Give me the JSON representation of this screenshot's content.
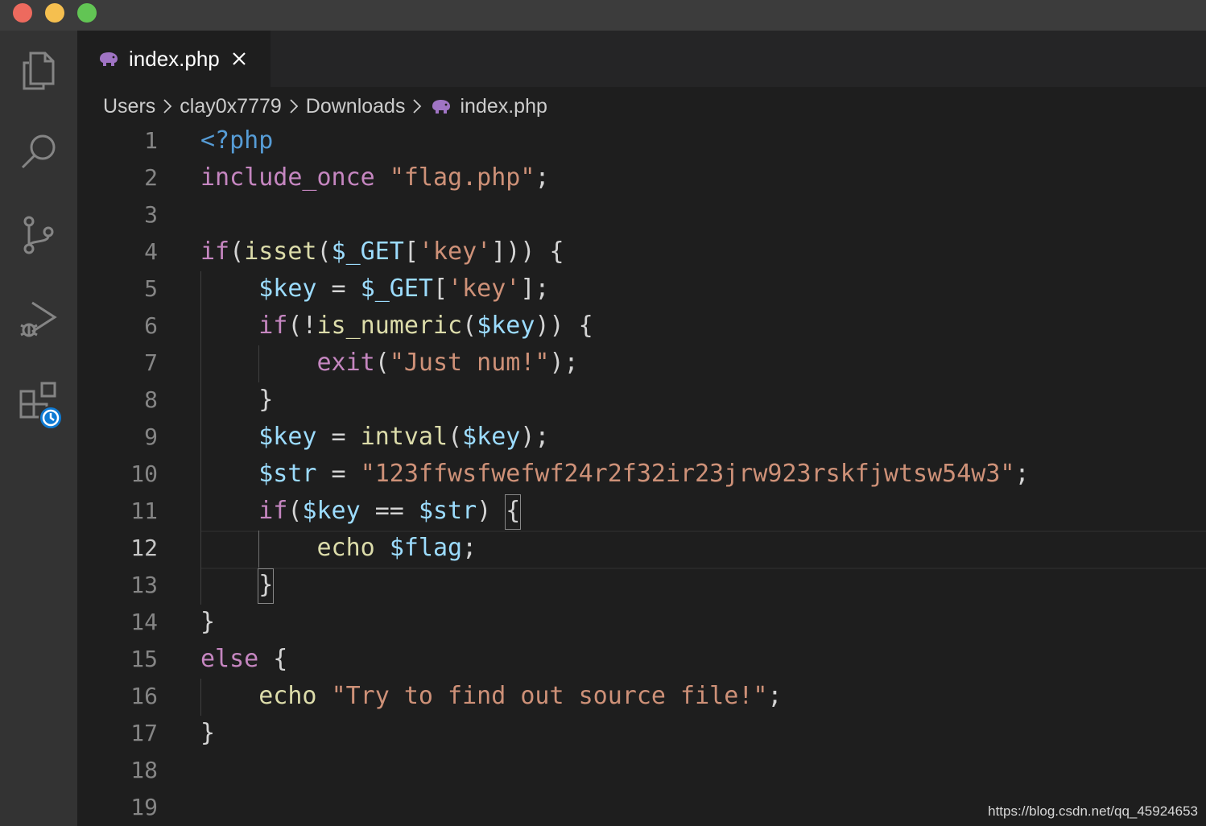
{
  "window": {
    "traffic_lights": [
      "close",
      "minimize",
      "zoom"
    ]
  },
  "activity_bar": {
    "items": [
      {
        "name": "explorer",
        "icon": "files-icon"
      },
      {
        "name": "search",
        "icon": "search-icon"
      },
      {
        "name": "source-control",
        "icon": "source-control-icon"
      },
      {
        "name": "run-debug",
        "icon": "run-debug-icon"
      },
      {
        "name": "extensions",
        "icon": "extensions-icon",
        "badge": "clock-badge-icon"
      }
    ]
  },
  "tab": {
    "label": "index.php",
    "icon": "php-elephant-icon",
    "close_icon": "close-icon"
  },
  "breadcrumb": {
    "items": [
      "Users",
      "clay0x7779",
      "Downloads",
      "index.php"
    ]
  },
  "editor": {
    "active_line": 12,
    "line_numbers": [
      "1",
      "2",
      "3",
      "4",
      "5",
      "6",
      "7",
      "8",
      "9",
      "10",
      "11",
      "12",
      "13",
      "14",
      "15",
      "16",
      "17",
      "18",
      "19"
    ],
    "lines": [
      {
        "text": "<?php",
        "tokens": [
          [
            "tag",
            "<?php"
          ]
        ]
      },
      {
        "text": "include_once \"flag.php\";",
        "tokens": [
          [
            "kw",
            "include_once"
          ],
          [
            "pun",
            " "
          ],
          [
            "str",
            "\"flag.php\""
          ],
          [
            "pun",
            ";"
          ]
        ]
      },
      {
        "text": "",
        "tokens": []
      },
      {
        "text": "if(isset($_GET['key'])) {",
        "tokens": [
          [
            "kw",
            "if"
          ],
          [
            "pun",
            "("
          ],
          [
            "fn",
            "isset"
          ],
          [
            "pun",
            "("
          ],
          [
            "var",
            "$_GET"
          ],
          [
            "pun",
            "["
          ],
          [
            "str",
            "'key'"
          ],
          [
            "pun",
            "])) {"
          ]
        ]
      },
      {
        "text": "    $key = $_GET['key'];",
        "tokens": [
          [
            "pun",
            "    "
          ],
          [
            "var",
            "$key"
          ],
          [
            "pun",
            " = "
          ],
          [
            "var",
            "$_GET"
          ],
          [
            "pun",
            "["
          ],
          [
            "str",
            "'key'"
          ],
          [
            "pun",
            "];"
          ]
        ]
      },
      {
        "text": "    if(!is_numeric($key)) {",
        "tokens": [
          [
            "pun",
            "    "
          ],
          [
            "kw",
            "if"
          ],
          [
            "pun",
            "(!"
          ],
          [
            "fn",
            "is_numeric"
          ],
          [
            "pun",
            "("
          ],
          [
            "var",
            "$key"
          ],
          [
            "pun",
            ")) {"
          ]
        ]
      },
      {
        "text": "        exit(\"Just num!\");",
        "tokens": [
          [
            "pun",
            "        "
          ],
          [
            "kw",
            "exit"
          ],
          [
            "pun",
            "("
          ],
          [
            "str",
            "\"Just num!\""
          ],
          [
            "pun",
            ");"
          ]
        ]
      },
      {
        "text": "    }",
        "tokens": [
          [
            "pun",
            "    }"
          ]
        ]
      },
      {
        "text": "    $key = intval($key);",
        "tokens": [
          [
            "pun",
            "    "
          ],
          [
            "var",
            "$key"
          ],
          [
            "pun",
            " = "
          ],
          [
            "fn",
            "intval"
          ],
          [
            "pun",
            "("
          ],
          [
            "var",
            "$key"
          ],
          [
            "pun",
            ");"
          ]
        ]
      },
      {
        "text": "    $str = \"123ffwsfwefwf24r2f32ir23jrw923rskfjwtsw54w3\";",
        "tokens": [
          [
            "pun",
            "    "
          ],
          [
            "var",
            "$str"
          ],
          [
            "pun",
            " = "
          ],
          [
            "str",
            "\"123ffwsfwefwf24r2f32ir23jrw923rskfjwtsw54w3\""
          ],
          [
            "pun",
            ";"
          ]
        ]
      },
      {
        "text": "    if($key == $str) {",
        "tokens": [
          [
            "pun",
            "    "
          ],
          [
            "kw",
            "if"
          ],
          [
            "pun",
            "("
          ],
          [
            "var",
            "$key"
          ],
          [
            "pun",
            " == "
          ],
          [
            "var",
            "$str"
          ],
          [
            "pun",
            ") {"
          ]
        ]
      },
      {
        "text": "        echo $flag;",
        "tokens": [
          [
            "pun",
            "        "
          ],
          [
            "fn",
            "echo"
          ],
          [
            "pun",
            " "
          ],
          [
            "var",
            "$flag"
          ],
          [
            "pun",
            ";"
          ]
        ]
      },
      {
        "text": "    }",
        "tokens": [
          [
            "pun",
            "    }"
          ]
        ]
      },
      {
        "text": "}",
        "tokens": [
          [
            "pun",
            "}"
          ]
        ]
      },
      {
        "text": "else {",
        "tokens": [
          [
            "kw",
            "else"
          ],
          [
            "pun",
            " {"
          ]
        ]
      },
      {
        "text": "    echo \"Try to find out source file!\";",
        "tokens": [
          [
            "pun",
            "    "
          ],
          [
            "fn",
            "echo"
          ],
          [
            "pun",
            " "
          ],
          [
            "str",
            "\"Try to find out source file!\""
          ],
          [
            "pun",
            ";"
          ]
        ]
      },
      {
        "text": "}",
        "tokens": [
          [
            "pun",
            "}"
          ]
        ]
      },
      {
        "text": "",
        "tokens": []
      },
      {
        "text": "",
        "tokens": []
      }
    ]
  },
  "watermark": "https://blog.csdn.net/qq_45924653",
  "colors": {
    "background": "#1e1e1e",
    "titlebar": "#3c3c3c",
    "activity_bar": "#333333",
    "tag": "#569cd6",
    "keyword": "#c586c0",
    "string": "#ce9178",
    "variable": "#9cdcfe",
    "function": "#dcdcaa"
  }
}
